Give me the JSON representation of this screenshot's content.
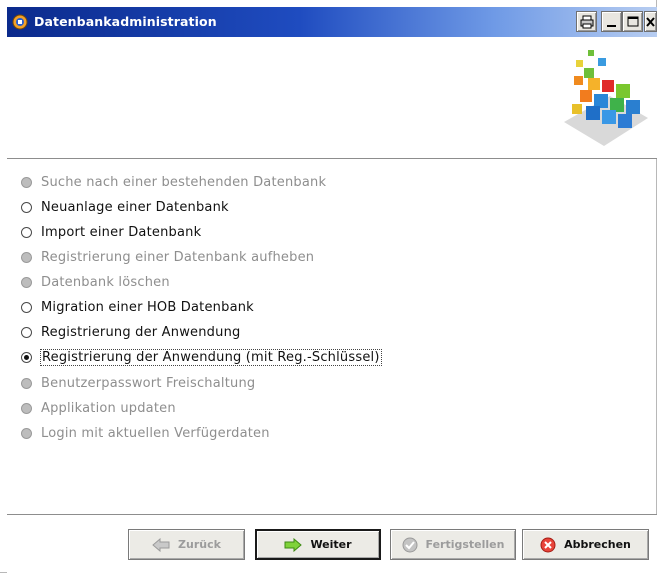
{
  "window": {
    "title": "Datenbankadministration"
  },
  "titlebar": {
    "icons": [
      "app-icon",
      "print-icon",
      "minimize-icon",
      "maximize-icon",
      "close-icon"
    ]
  },
  "options": [
    {
      "label": "Suche nach einer bestehenden Datenbank",
      "enabled": false,
      "checked": false
    },
    {
      "label": "Neuanlage einer Datenbank",
      "enabled": true,
      "checked": false
    },
    {
      "label": "Import einer Datenbank",
      "enabled": true,
      "checked": false
    },
    {
      "label": "Registrierung einer Datenbank aufheben",
      "enabled": false,
      "checked": false
    },
    {
      "label": "Datenbank löschen",
      "enabled": false,
      "checked": false
    },
    {
      "label": "Migration einer HOB Datenbank",
      "enabled": true,
      "checked": false
    },
    {
      "label": "Registrierung der Anwendung",
      "enabled": true,
      "checked": false
    },
    {
      "label": "Registrierung der Anwendung (mit Reg.-Schlüssel)",
      "enabled": true,
      "checked": true
    },
    {
      "label": "Benutzerpasswort Freischaltung",
      "enabled": false,
      "checked": false
    },
    {
      "label": "Applikation updaten",
      "enabled": false,
      "checked": false
    },
    {
      "label": "Login mit aktuellen Verfügerdaten",
      "enabled": false,
      "checked": false
    }
  ],
  "buttons": {
    "back": {
      "label": "Zurück",
      "enabled": false,
      "icon": "arrow-left-icon"
    },
    "next": {
      "label": "Weiter",
      "enabled": true,
      "icon": "arrow-right-icon"
    },
    "finish": {
      "label": "Fertigstellen",
      "enabled": false,
      "icon": "check-icon"
    },
    "cancel": {
      "label": "Abbrechen",
      "enabled": true,
      "icon": "cancel-icon"
    }
  },
  "colors": {
    "titlebar_start": "#0b2a8c",
    "titlebar_end": "#b7cdf1",
    "disabled_text": "#8e8e8e"
  }
}
